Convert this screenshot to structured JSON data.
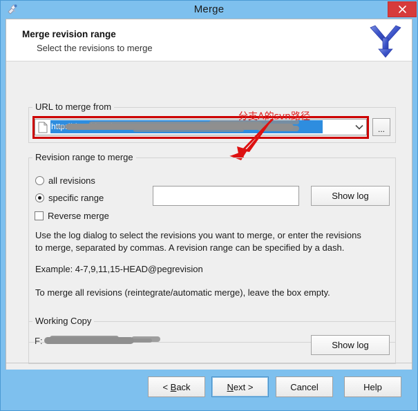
{
  "window": {
    "title": "Merge",
    "icon": "merge-tortoise-icon",
    "close_label": "×",
    "frame_color": "#7ec0ee",
    "close_color": "#d63b3b"
  },
  "header": {
    "title": "Merge revision range",
    "subtitle": "Select the revisions to merge",
    "logo_icon": "merge-arrow-logo"
  },
  "url_group": {
    "label": "URL to merge from",
    "combo": {
      "value": "http://                      /svn/                           /trunk",
      "redacted": true,
      "selected": true,
      "file_icon": "document-icon",
      "dropdown_icon": "chevron-down-icon"
    },
    "browse_button": "...",
    "highlight_color": "#cc0000"
  },
  "annotation": {
    "text": "分支A的svn路径",
    "color": "#e02020",
    "arrow_icon": "red-arrow-icon"
  },
  "revision_group": {
    "label": "Revision range to merge",
    "options": [
      {
        "label": "all revisions",
        "checked": false
      },
      {
        "label": "specific range",
        "checked": true
      }
    ],
    "range_input": {
      "value": "",
      "placeholder": ""
    },
    "show_log_button": "Show log",
    "reverse_merge": {
      "label": "Reverse merge",
      "checked": false
    },
    "help_paragraphs": [
      "Use the log dialog to select the revisions you want to merge, or enter the revisions to merge, separated by commas. A revision range can be specified by a dash.",
      "Example: 4-7,9,11,15-HEAD@pegrevision",
      "To merge all revisions (reintegrate/automatic merge), leave the box empty."
    ]
  },
  "working_copy_group": {
    "label": "Working Copy",
    "path_prefix": "F:",
    "path_redacted": true,
    "show_log_button": "Show log"
  },
  "footer": {
    "buttons": [
      {
        "name": "back",
        "prefix": "< ",
        "accel": "B",
        "suffix": "ack",
        "default": false
      },
      {
        "name": "next",
        "prefix": "",
        "accel": "N",
        "suffix": "ext >",
        "default": true
      },
      {
        "name": "cancel",
        "prefix": "",
        "accel": "",
        "suffix": "Cancel",
        "default": false
      },
      {
        "name": "help",
        "prefix": "",
        "accel": "",
        "suffix": "Help",
        "default": false
      }
    ]
  }
}
